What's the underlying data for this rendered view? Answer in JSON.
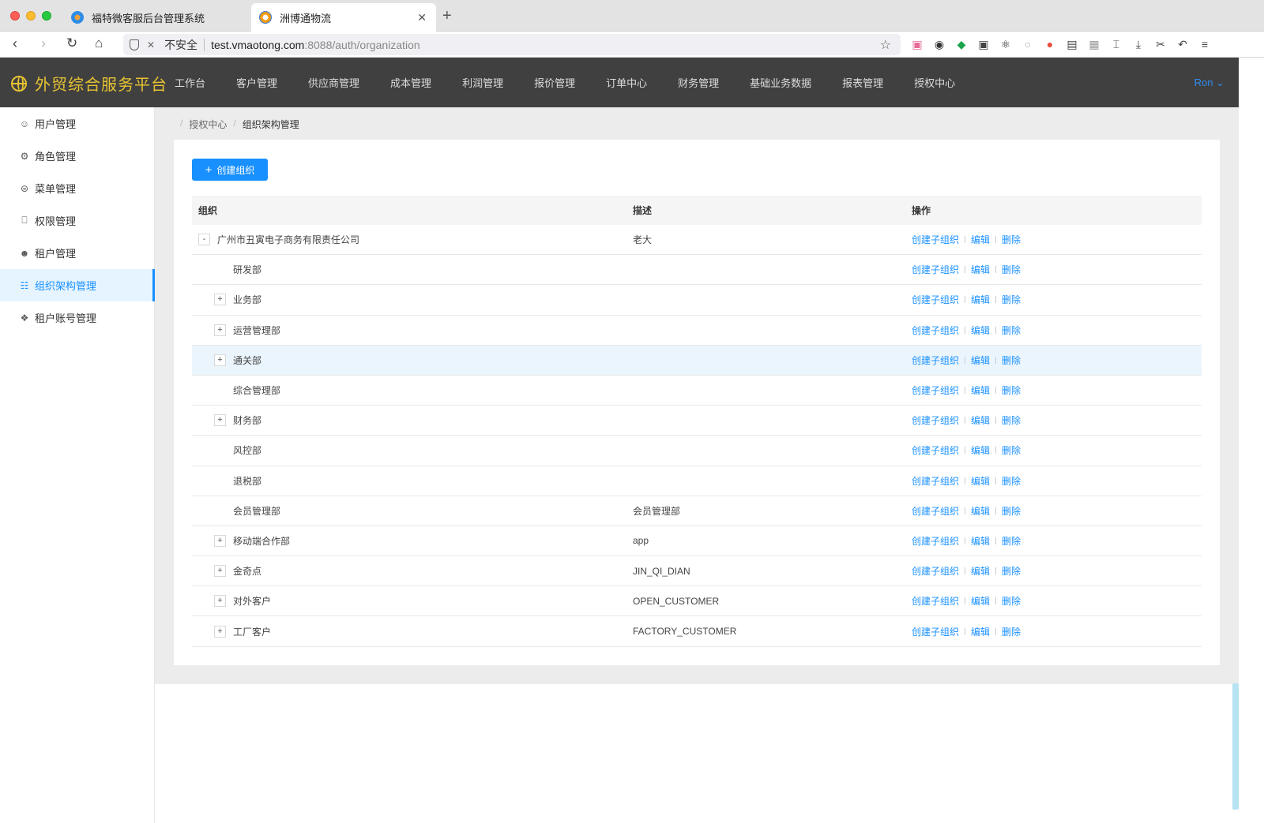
{
  "browser": {
    "tabs": [
      {
        "title": "福特微客服后台管理系统"
      },
      {
        "title": "洲博通物流"
      }
    ],
    "url": {
      "insecure_label": "不安全",
      "host": "test.vmaotong.com",
      "path": ":8088/auth/organization"
    }
  },
  "header": {
    "logo_text": "外贸综合服务平台",
    "nav": [
      "工作台",
      "客户管理",
      "供应商管理",
      "成本管理",
      "利润管理",
      "报价管理",
      "订单中心",
      "财务管理",
      "基础业务数据",
      "报表管理",
      "授权中心"
    ],
    "user": "Ron ⌄"
  },
  "sidebar": {
    "items": [
      {
        "label": "用户管理",
        "icon": "user-icon"
      },
      {
        "label": "角色管理",
        "icon": "role-icon"
      },
      {
        "label": "菜单管理",
        "icon": "menu-icon"
      },
      {
        "label": "权限管理",
        "icon": "lock-icon"
      },
      {
        "label": "租户管理",
        "icon": "tenant-icon"
      },
      {
        "label": "组织架构管理",
        "icon": "org-tree-icon"
      },
      {
        "label": "租户账号管理",
        "icon": "account-icon"
      }
    ],
    "active_index": 5
  },
  "breadcrumb": [
    "授权中心",
    "组织架构管理"
  ],
  "toolbar": {
    "create_label": "创建组织"
  },
  "table": {
    "columns": [
      "组织",
      "描述",
      "操作"
    ],
    "actions": [
      "创建子组织",
      "编辑",
      "删除"
    ],
    "rows": [
      {
        "name": "广州市丑寅电子商务有限责任公司",
        "desc": "老大",
        "level": 0,
        "expander": "-"
      },
      {
        "name": "研发部",
        "desc": "",
        "level": 1,
        "expander": ""
      },
      {
        "name": "业务部",
        "desc": "",
        "level": 1,
        "expander": "+"
      },
      {
        "name": "运营管理部",
        "desc": "",
        "level": 1,
        "expander": "+"
      },
      {
        "name": "通关部",
        "desc": "",
        "level": 1,
        "expander": "+",
        "highlighted": true
      },
      {
        "name": "综合管理部",
        "desc": "",
        "level": 1,
        "expander": ""
      },
      {
        "name": "财务部",
        "desc": "",
        "level": 1,
        "expander": "+"
      },
      {
        "name": "风控部",
        "desc": "",
        "level": 1,
        "expander": ""
      },
      {
        "name": "退税部",
        "desc": "",
        "level": 1,
        "expander": ""
      },
      {
        "name": "会员管理部",
        "desc": "会员管理部",
        "level": 1,
        "expander": ""
      },
      {
        "name": "移动端合作部",
        "desc": "app",
        "level": 1,
        "expander": "+"
      },
      {
        "name": "金奇点",
        "desc": "JIN_QI_DIAN",
        "level": 1,
        "expander": "+"
      },
      {
        "name": "对外客户",
        "desc": "OPEN_CUSTOMER",
        "level": 1,
        "expander": "+"
      },
      {
        "name": "工厂客户",
        "desc": "FACTORY_CUSTOMER",
        "level": 1,
        "expander": "+"
      }
    ]
  },
  "colors": {
    "primary": "#1890ff",
    "header_bg": "#404040",
    "logo": "#e8c332"
  }
}
